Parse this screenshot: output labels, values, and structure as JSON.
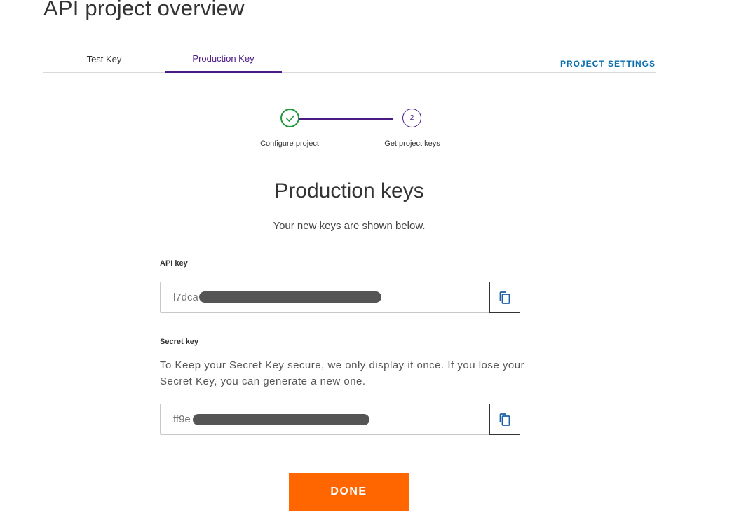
{
  "page": {
    "title": "API project overview"
  },
  "tabs": [
    {
      "label": "Test Key",
      "active": false
    },
    {
      "label": "Production Key",
      "active": true
    }
  ],
  "header": {
    "settings_label": "PROJECT SETTINGS"
  },
  "stepper": {
    "steps": [
      {
        "label": "Configure project",
        "status": "complete",
        "icon": "check-icon"
      },
      {
        "label": "Get project keys",
        "status": "current",
        "number": "2"
      }
    ]
  },
  "main": {
    "title": "Production keys",
    "subtitle": "Your new keys are shown below.",
    "api_key": {
      "label": "API key",
      "value": "l7dca",
      "copy_icon": "copy-icon"
    },
    "secret_key": {
      "label": "Secret key",
      "note": "To Keep your Secret Key secure, we only display it once. If you lose your Secret Key, you can generate a new one.",
      "value": "ff9e",
      "copy_icon": "copy-icon"
    },
    "done_label": "DONE"
  },
  "colors": {
    "accent_purple": "#4a1a85",
    "success_green": "#1f9a3a",
    "link_blue": "#0a6fae",
    "done_orange": "#ff6600"
  }
}
